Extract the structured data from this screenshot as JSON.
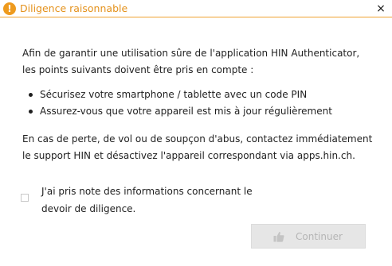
{
  "dialog": {
    "title": "Diligence raisonnable",
    "title_icon": "warning-icon",
    "title_color": "#e4911b",
    "close_label": "×"
  },
  "content": {
    "intro": "Afin de garantir une utilisation sûre de l'application HIN Authenticator, les points suivants doivent être pris en compte :",
    "bullets": [
      "Sécurisez votre smartphone / tablette avec un code PIN",
      "Assurez-vous que votre appareil est mis à jour régulièrement"
    ],
    "warning": "En cas de perte, de vol ou de soupçon d'abus, contactez immédiatement le support HIN et désactivez l'appareil correspondant via apps.hin.ch."
  },
  "acknowledgement": {
    "checked": false,
    "label": "J'ai pris note des informations concernant le devoir de diligence."
  },
  "actions": {
    "continue_label": "Continuer",
    "continue_icon": "thumbs-up-icon",
    "continue_enabled": false
  }
}
